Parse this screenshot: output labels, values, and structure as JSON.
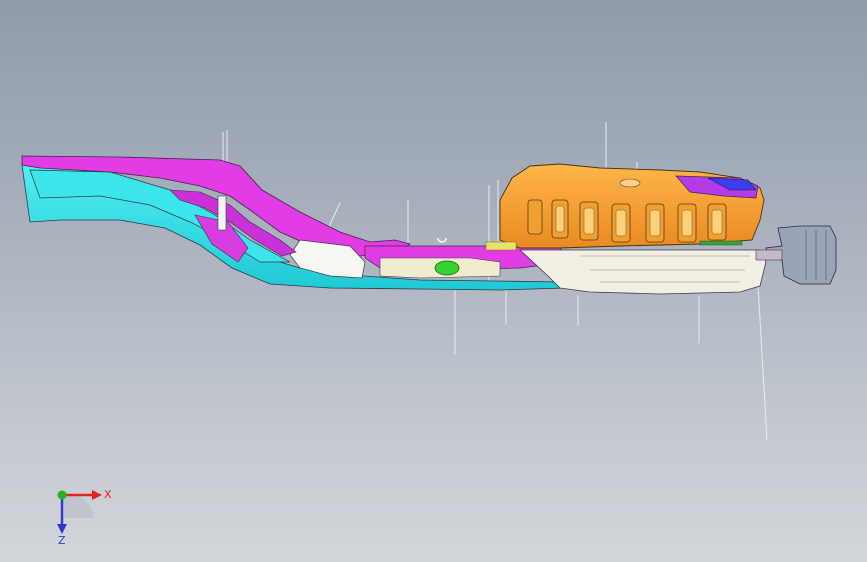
{
  "viewport": {
    "background_top": "#8f9aab",
    "background_bottom": "#d3d6da"
  },
  "model": {
    "part_colors": {
      "magenta": "#e23ce6",
      "cyan": "#33e3e8",
      "orange": "#f4a23a",
      "white": "#f4f4f0",
      "cream": "#efeccf",
      "gray": "#9aa4b8",
      "green": "#36d22e",
      "blue": "#3d3df0",
      "yellow": "#e9e26a",
      "outline": "#3a3a46"
    }
  },
  "triad": {
    "x_label": "X",
    "z_label": "Z",
    "x_color": "#e02424",
    "y_color": "#22b422",
    "z_color": "#2a3ad0",
    "icons": [
      "x-axis-arrow-icon",
      "z-axis-arrow-icon",
      "y-axis-dot-icon"
    ]
  }
}
